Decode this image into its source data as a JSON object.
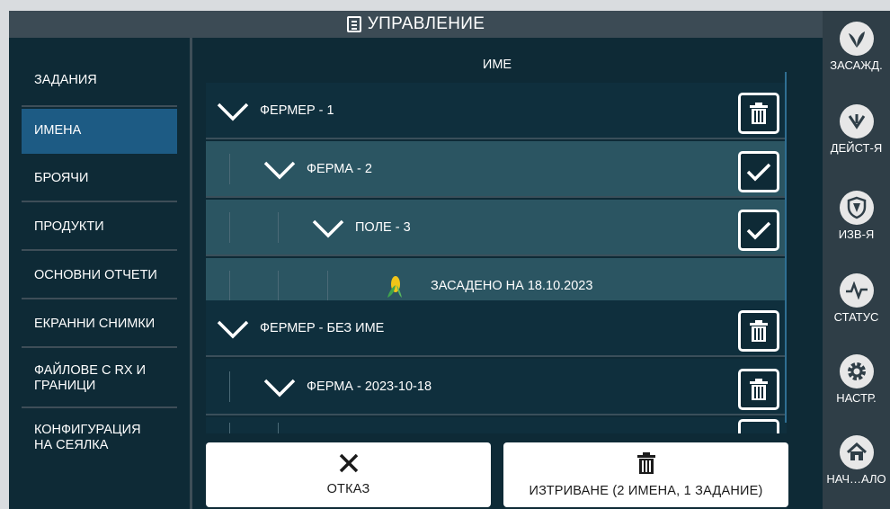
{
  "window": {
    "title": "УПРАВЛЕНИЕ"
  },
  "sidebar": {
    "items": [
      {
        "label": "ЗАДАНИЯ",
        "active": false
      },
      {
        "label": "ИМЕНА",
        "active": true
      },
      {
        "label": "БРОЯЧИ",
        "active": false
      },
      {
        "label": "ПРОДУКТИ",
        "active": false
      },
      {
        "label": "ОСНОВНИ ОТЧЕТИ",
        "active": false
      },
      {
        "label": "ЕКРАННИ СНИМКИ",
        "active": false
      },
      {
        "label": "ФАЙЛОВЕ С RX И ГРАНИЦИ",
        "active": false
      },
      {
        "label": "КОНФИГУРАЦИЯ НА СЕЯЛКА",
        "active": false
      }
    ]
  },
  "main": {
    "column_header": "ИМЕ",
    "rows": [
      {
        "label": "ФЕРМЕР - 1",
        "level": 0,
        "action": "trash"
      },
      {
        "label": "ФЕРМА - 2",
        "level": 1,
        "action": "checked"
      },
      {
        "label": "ПОЛЕ - 3",
        "level": 2,
        "action": "checked"
      },
      {
        "label": "ЗАСАДЕНО НА 18.10.2023",
        "level": 3,
        "icon": "corn-icon"
      },
      {
        "label": "ФЕРМЕР - БЕЗ ИМЕ",
        "level": 0,
        "action": "trash"
      },
      {
        "label": "ФЕРМА - 2023-10-18",
        "level": 1,
        "action": "trash"
      }
    ]
  },
  "buttons": {
    "cancel_label": "ОТКАЗ",
    "delete_label": "ИЗТРИВАНЕ (2 ИМЕНА, 1 ЗАДАНИЕ)"
  },
  "rail": {
    "items": [
      {
        "label": "ЗАСАЖД.",
        "icon": "planting-icon"
      },
      {
        "label": "ДЕЙСТ-Я",
        "icon": "actions-icon"
      },
      {
        "label": "ИЗВ-Я",
        "icon": "alerts-shield-icon"
      },
      {
        "label": "СТАТУС",
        "icon": "status-pulse-icon"
      },
      {
        "label": "НАСТР.",
        "icon": "settings-gear-icon"
      },
      {
        "label": "НАЧ…АЛО",
        "icon": "home-icon"
      }
    ]
  },
  "colors": {
    "background": "#0e2a36",
    "active_item": "#1d5b84",
    "selected_row": "#2b5562",
    "rail": "#2f3e47",
    "title_bar": "#3c4b55"
  }
}
